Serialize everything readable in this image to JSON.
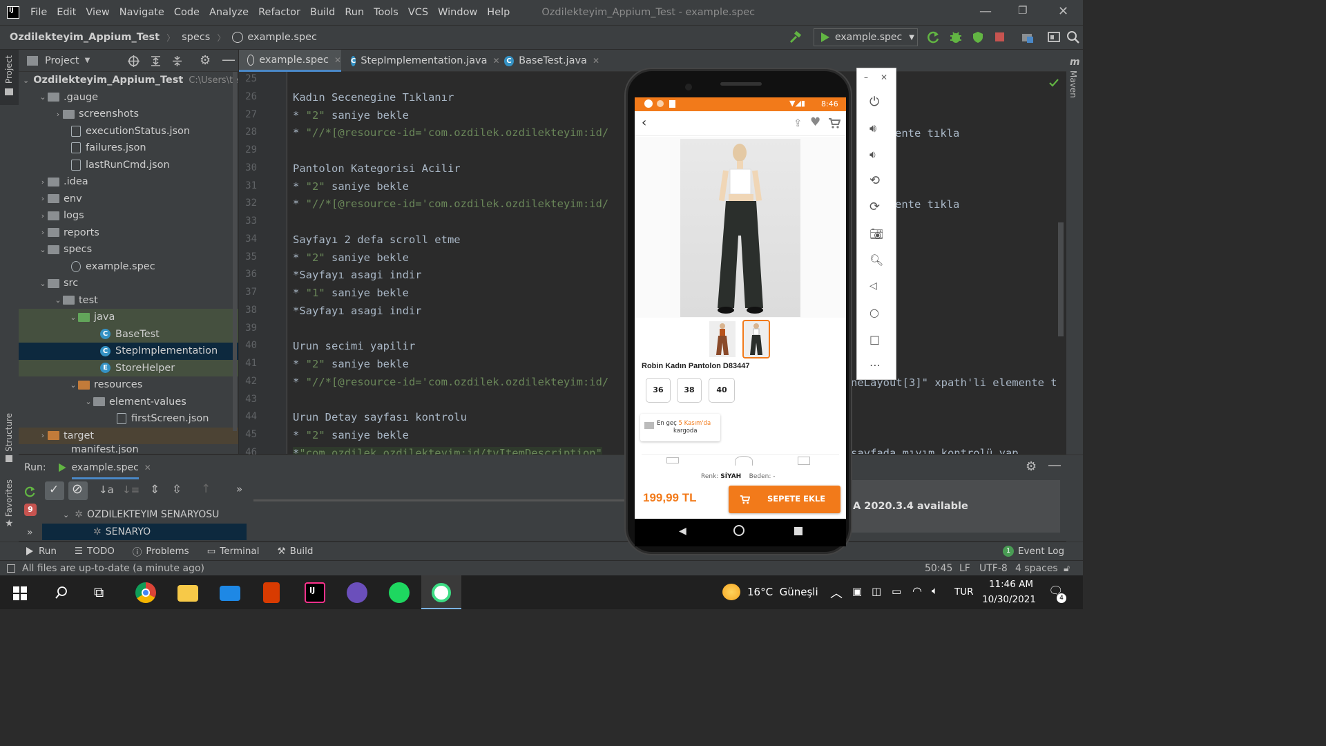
{
  "menubar": {
    "items": [
      "File",
      "Edit",
      "View",
      "Navigate",
      "Code",
      "Analyze",
      "Refactor",
      "Build",
      "Run",
      "Tools",
      "VCS",
      "Window",
      "Help"
    ],
    "window_title": "Ozdilekteyim_Appium_Test - example.spec"
  },
  "navbar": {
    "crumbs": [
      "Ozdilekteyim_Appium_Test",
      "specs",
      "example.spec"
    ],
    "run_config": "example.spec"
  },
  "project": {
    "title": "Project",
    "root": {
      "name": "Ozdilekteyim_Appium_Test",
      "path": "C:\\Users\\te"
    },
    "items": [
      {
        "label": ".gauge"
      },
      {
        "label": "screenshots"
      },
      {
        "label": "executionStatus.json"
      },
      {
        "label": "failures.json"
      },
      {
        "label": "lastRunCmd.json"
      },
      {
        "label": ".idea"
      },
      {
        "label": "env"
      },
      {
        "label": "logs"
      },
      {
        "label": "reports"
      },
      {
        "label": "specs"
      },
      {
        "label": "example.spec"
      },
      {
        "label": "src"
      },
      {
        "label": "test"
      },
      {
        "label": "java"
      },
      {
        "label": "BaseTest"
      },
      {
        "label": "StepImplementation"
      },
      {
        "label": "StoreHelper"
      },
      {
        "label": "resources"
      },
      {
        "label": "element-values"
      },
      {
        "label": "firstScreen.json"
      },
      {
        "label": "target"
      },
      {
        "label": "manifest.json"
      }
    ]
  },
  "editor_tabs": [
    "example.spec",
    "StepImplementation.java",
    "BaseTest.java"
  ],
  "code": {
    "line_numbers": [
      "25",
      "26",
      "27",
      "28",
      "29",
      "30",
      "31",
      "32",
      "33",
      "34",
      "35",
      "36",
      "37",
      "38",
      "39",
      "40",
      "41",
      "42",
      "43",
      "44",
      "45",
      "46"
    ],
    "lines": [
      "",
      "Kadın Secenegine Tıklanır",
      "* \"2\" saniye bekle",
      "* \"//*[@resource-id='com.ozdilek.ozdilekteyim:id/",
      "",
      "Pantolon Kategorisi Acilir",
      "* \"2\" saniye bekle",
      "* \"//*[@resource-id='com.ozdilek.ozdilekteyim:id/",
      "",
      "Sayfayı 2 defa scroll etme",
      "* \"2\" saniye bekle",
      "*Sayfayı asagi indir",
      "* \"1\" saniye bekle",
      "*Sayfayı asagi indir",
      "",
      "Urun secimi yapilir",
      "* \"2\" saniye bekle",
      "* \"//*[@resource-id='com.ozdilek.ozdilekteyim:id/",
      "",
      "Urun Detay sayfası kontrolu",
      "* \"2\" saniye bekle",
      "*\"com.ozdilek.ozdilekteyim:id/tvItemDescription\""
    ],
    "right_fragments": {
      "r28": "ente tıkla",
      "r32": "ente tıkla",
      "r42": "neLayout[3]\" xpath'li elemente t",
      "r46": "sayfada mıyım kontrolü yap"
    }
  },
  "run": {
    "label": "Run:",
    "tab": "example.spec",
    "tree": [
      "OZDILEKTEYIM SENARYOSU",
      "SENARYO"
    ],
    "fail_count": "9",
    "notification": "A 2020.3.4 available"
  },
  "bottom_tools": [
    "Run",
    "TODO",
    "Problems",
    "Terminal",
    "Build"
  ],
  "event_log": "Event Log",
  "event_log_count": "1",
  "status": {
    "message": "All files are up-to-date (a minute ago)",
    "position": "50:45",
    "line_sep": "LF",
    "encoding": "UTF-8",
    "indent": "4 spaces"
  },
  "side_labels": {
    "project": "Project",
    "structure": "Structure",
    "favorites": "Favorites",
    "maven": "Maven"
  },
  "phone": {
    "time": "8:46",
    "product_name": "Robin Kadın Pantolon D83447",
    "sizes": [
      "36",
      "38",
      "40"
    ],
    "delivery_prefix": "En geç ",
    "delivery_date": "5 Kasım'da",
    "delivery_suffix": "kargoda",
    "color_label": "Renk:",
    "color_value": "SİYAH",
    "size_label": "Beden:",
    "size_value": "-",
    "price": "199,99 TL",
    "add_to_cart": "SEPETE EKLE"
  },
  "taskbar": {
    "weather": "16°C  Güneşli",
    "lang": "TUR",
    "time": "11:46 AM",
    "date": "10/30/2021",
    "notif_count": "4"
  },
  "colors": {
    "accent": "#f27a1a",
    "ide_bg": "#2b2b2b",
    "panel": "#3c3f41",
    "selection": "#0d293e",
    "string_green": "#6a8759"
  }
}
